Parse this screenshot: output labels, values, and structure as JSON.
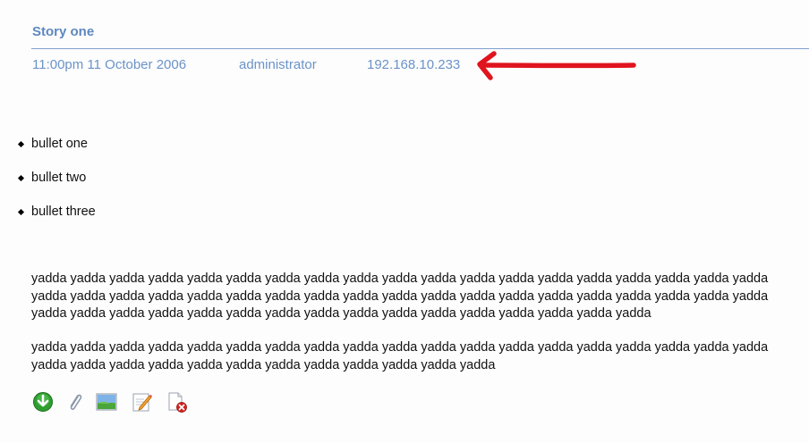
{
  "story": {
    "title": "Story one",
    "date": "11:00pm 11 October 2006",
    "author": "administrator",
    "ip": "192.168.10.233"
  },
  "bullets": [
    "bullet one",
    "bullet two",
    "bullet three"
  ],
  "paragraphs": [
    {
      "lines": [
        "yadda yadda yadda yadda yadda yadda yadda yadda yadda yadda yadda yadda yadda yadda yadda yadda yadda yadda yadda",
        "yadda yadda yadda yadda yadda yadda yadda yadda yadda yadda yadda yadda yadda yadda yadda yadda yadda yadda yadda",
        "yadda yadda yadda yadda yadda yadda yadda yadda yadda yadda yadda yadda yadda yadda yadda yadda"
      ]
    },
    {
      "lines": [
        "yadda yadda yadda yadda yadda yadda yadda yadda yadda yadda yadda yadda yadda yadda yadda yadda yadda yadda yadda",
        "yadda yadda yadda yadda yadda yadda yadda yadda yadda yadda yadda yadda"
      ]
    }
  ],
  "toolbar": {
    "icons": [
      "download-icon",
      "attachment-icon",
      "image-icon",
      "edit-icon",
      "delete-icon"
    ]
  },
  "colors": {
    "link": "#6b93c8",
    "title": "#5d88c0",
    "rule": "#7fa0cc",
    "annotation_arrow": "#e0141e"
  }
}
